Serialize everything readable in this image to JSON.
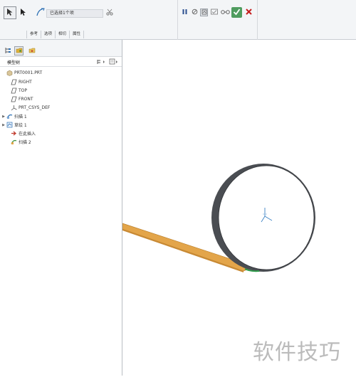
{
  "toolbar": {
    "trajectory_value": "已选择1个项",
    "tabs": [
      {
        "label": "参考"
      },
      {
        "label": "选项"
      },
      {
        "label": "相切"
      },
      {
        "label": "属性"
      }
    ]
  },
  "tree": {
    "title": "模型树",
    "items": [
      {
        "label": "PRT0001.PRT"
      },
      {
        "label": "RIGHT"
      },
      {
        "label": "TOP"
      },
      {
        "label": "FRONT"
      },
      {
        "label": "PRT_CSYS_DEF"
      },
      {
        "label": "扫描 1"
      },
      {
        "label": "草绘 1"
      },
      {
        "label": "在此插入"
      },
      {
        "label": "扫描 2"
      }
    ]
  },
  "watermark": "软件技巧",
  "colors": {
    "accent_green": "#2e9b4a",
    "cancel_red": "#c41c1c",
    "shell_dark": "#4a4d52",
    "strip_orange": "#e3a54a"
  }
}
